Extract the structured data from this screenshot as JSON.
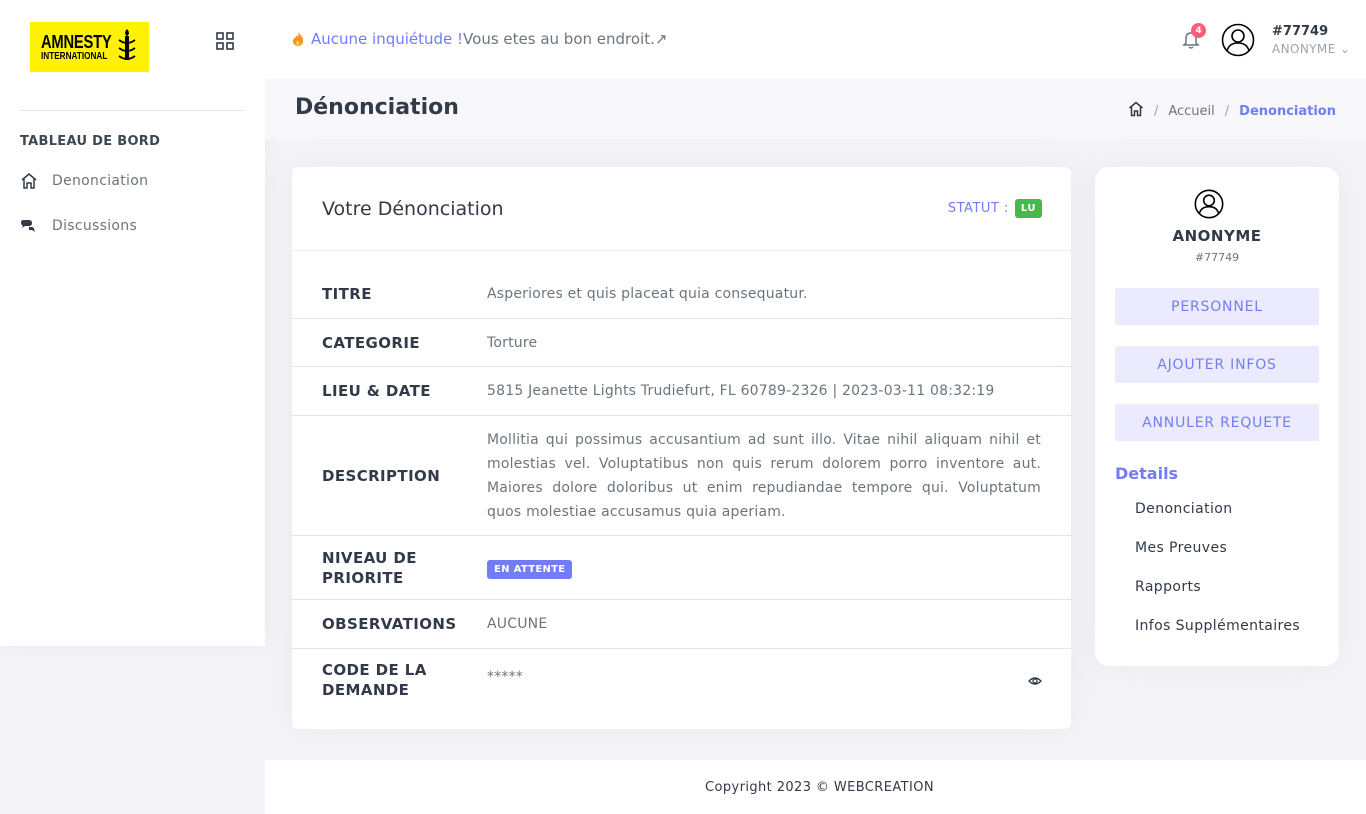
{
  "brand": {
    "logo_line1": "AMNESTY",
    "logo_line2": "INTERNATIONAL",
    "logo_bg": "#fff200"
  },
  "sidebar": {
    "section_title": "TABLEAU DE BORD",
    "items": [
      {
        "label": "Denonciation",
        "icon": "home-icon"
      },
      {
        "label": "Discussions",
        "icon": "chat-icon"
      }
    ]
  },
  "topbar": {
    "notice_highlight": "Aucune inquiétude !",
    "notice_rest": "Vous etes au bon endroit.",
    "notice_arrow": "↗",
    "notification_count": "4",
    "user_id": "#77749",
    "user_role": "ANONYME"
  },
  "page": {
    "title": "Dénonciation",
    "breadcrumb": {
      "home_icon": "home-icon",
      "accueil": "Accueil",
      "current": "Denonciation"
    }
  },
  "card": {
    "title": "Votre Dénonciation",
    "statut_label": "STATUT :",
    "statut_value": "LU",
    "fields": {
      "titre": {
        "label": "TITRE",
        "value": "Asperiores et quis placeat quia consequatur."
      },
      "categorie": {
        "label": "CATEGORIE",
        "value": "Torture"
      },
      "lieu_date": {
        "label": "LIEU & DATE",
        "value": "5815 Jeanette Lights Trudiefurt, FL 60789-2326 | 2023-03-11 08:32:19"
      },
      "description": {
        "label": "DESCRIPTION",
        "value": "Mollitia qui possimus accusantium ad sunt illo. Vitae nihil aliquam nihil et molestias vel. Voluptatibus non quis rerum dolorem porro inventore aut. Maiores dolore doloribus ut enim repudiandae tempore qui. Voluptatum quos molestiae accusamus quia aperiam."
      },
      "priorite": {
        "label_line1": "NIVEAU DE",
        "label_line2": "PRIORITE",
        "value": "EN ATTENTE"
      },
      "observations": {
        "label": "OBSERVATIONS",
        "value": "AUCUNE"
      },
      "code": {
        "label_line1": "CODE DE LA",
        "label_line2": "DEMANDE",
        "value": "*****"
      }
    }
  },
  "profile": {
    "name": "ANONYME",
    "id": "#77749",
    "buttons": {
      "personnel": "PERSONNEL",
      "ajouter": "AJOUTER INFOS",
      "annuler": "ANNULER REQUETE"
    },
    "details_title": "Details",
    "links": [
      "Denonciation",
      "Mes Preuves",
      "Rapports",
      "Infos Supplémentaires"
    ]
  },
  "footer": {
    "text": "Copyright 2023 © WEBCREATION"
  },
  "colors": {
    "accent": "#727cf5",
    "success": "#45b94a",
    "danger": "#fa5c7c"
  }
}
